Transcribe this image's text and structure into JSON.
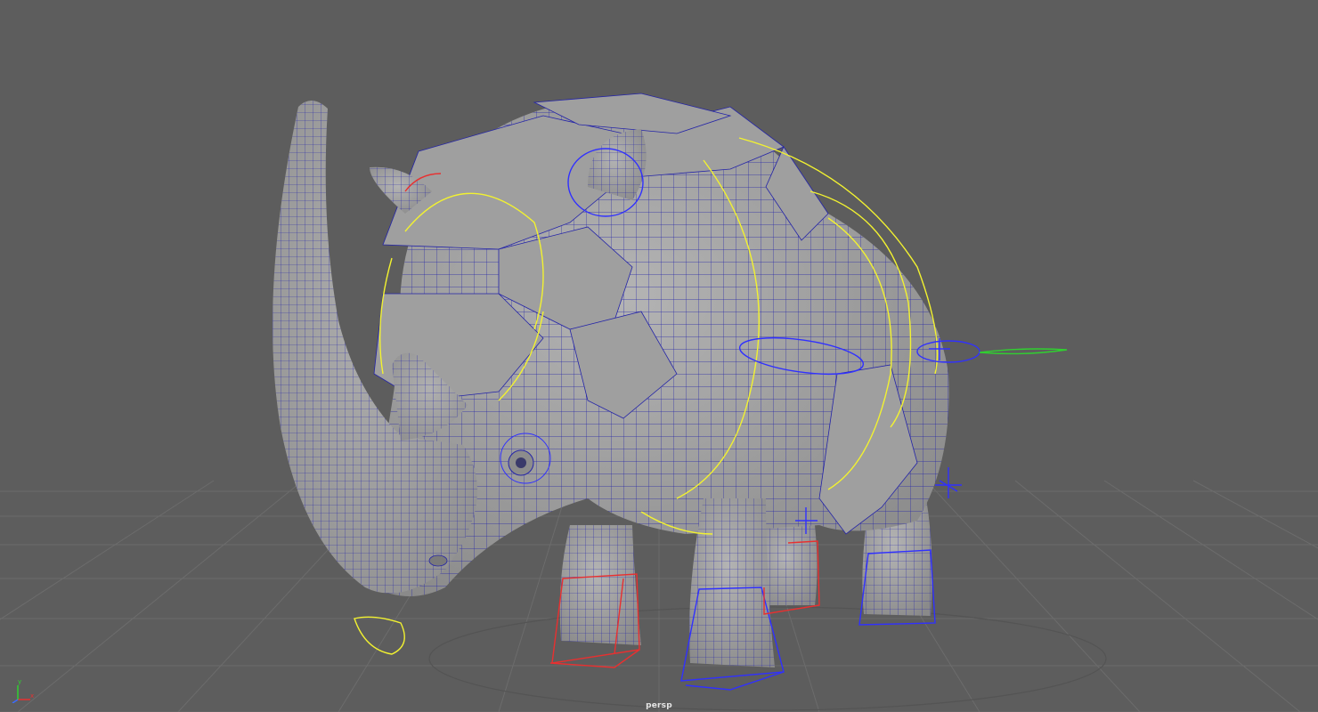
{
  "viewport": {
    "camera": "persp",
    "background": "#5d5d5d"
  },
  "colors": {
    "grid": "#6a6a6a",
    "mesh_fill": "#a8a8a8",
    "mesh_shade": "#8f8f8f",
    "wire": "#2424a8",
    "rig_curve": "#f2f230",
    "ik_box": "#e83030",
    "fk_box": "#3030ff",
    "tail_ctrl": "#30d030"
  },
  "gizmo": {
    "axes": [
      "X",
      "Y",
      "Z"
    ],
    "icon": "axis-gizmo-icon"
  }
}
